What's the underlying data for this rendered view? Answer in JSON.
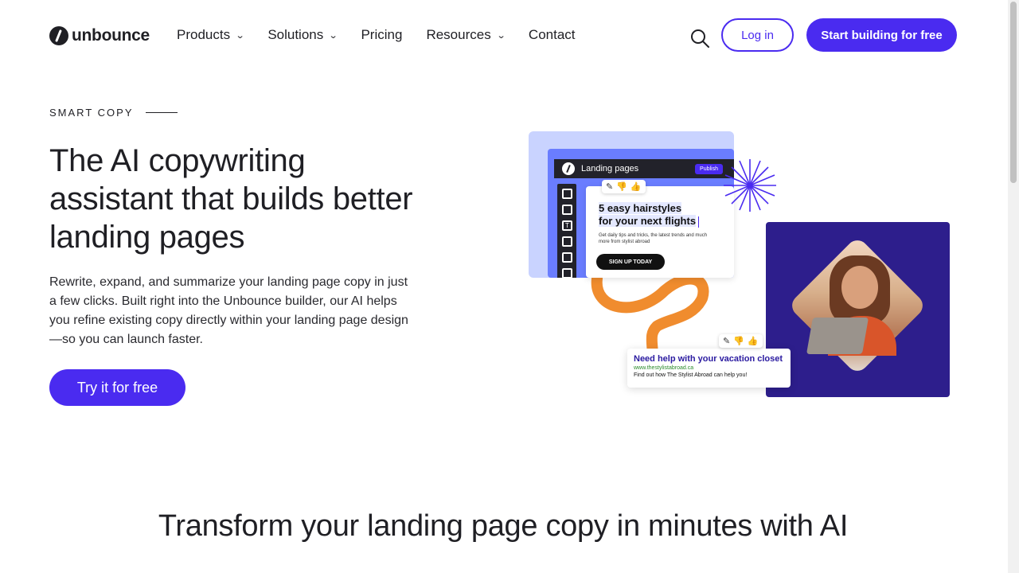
{
  "header": {
    "logo_text": "unbounce",
    "nav": [
      {
        "label": "Products",
        "has_dropdown": true
      },
      {
        "label": "Solutions",
        "has_dropdown": true
      },
      {
        "label": "Pricing",
        "has_dropdown": false
      },
      {
        "label": "Resources",
        "has_dropdown": true
      },
      {
        "label": "Contact",
        "has_dropdown": false
      }
    ],
    "login_label": "Log in",
    "start_label": "Start building for free"
  },
  "hero": {
    "eyebrow": "SMART COPY",
    "title": "The AI copywriting assistant that builds better landing pages",
    "description": "Rewrite, expand, and summarize your landing page copy in just a few clicks. Built right into the Unbounce builder, our AI helps you refine existing copy directly within your landing page design—so you can launch faster.",
    "cta_label": "Try it for free"
  },
  "illustration": {
    "editor_title": "Landing pages",
    "publish_label": "Publish",
    "card_headline_1": "5 easy hairstyles",
    "card_headline_2": "for your next flights",
    "card_subtext": "Get daily tips and tricks, the latest trends and much more from stylist abroad",
    "signup_label": "SIGN UP TODAY",
    "ad_title": "Need help with your vacation closet",
    "ad_url": "www.thestylistabroad.ca",
    "ad_desc": "Find out how The Stylist Abroad can help you!",
    "tool_text_glyph": "T"
  },
  "section2": {
    "title": "Transform your landing page copy in minutes with AI"
  },
  "colors": {
    "brand": "#4a2bf0",
    "orange": "#f08c2e",
    "photo_bg": "#2d1e8c"
  }
}
